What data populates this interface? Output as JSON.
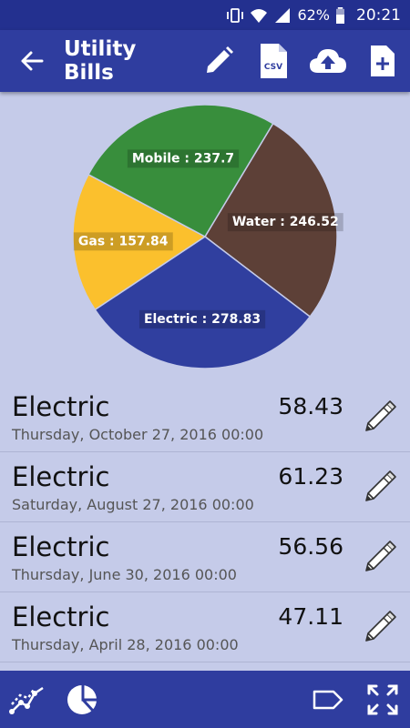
{
  "status_bar": {
    "battery": "62%",
    "time": "20:21",
    "icons": [
      "vibrate-icon",
      "wifi-icon",
      "signal-icon",
      "battery-icon"
    ]
  },
  "app_bar": {
    "title": "Utility Bills",
    "actions": [
      "edit-icon",
      "csv-export-icon",
      "cloud-upload-icon",
      "add-file-icon"
    ]
  },
  "chart_data": {
    "type": "pie",
    "slices": [
      {
        "label": "Water : 246.52",
        "name": "Water",
        "value": 246.52,
        "color": "#5d4037"
      },
      {
        "label": "Electric : 278.83",
        "name": "Electric",
        "value": 278.83,
        "color": "#303f9f"
      },
      {
        "label": "Gas : 157.84",
        "name": "Gas",
        "value": 157.84,
        "color": "#fbc02d"
      },
      {
        "label": "Mobile : 237.7",
        "name": "Mobile",
        "value": 237.7,
        "color": "#388e3c"
      }
    ]
  },
  "bills": [
    {
      "name": "Electric",
      "date": "Thursday, October 27, 2016 00:00",
      "amount": "58.43"
    },
    {
      "name": "Electric",
      "date": "Saturday, August 27, 2016 00:00",
      "amount": "61.23"
    },
    {
      "name": "Electric",
      "date": "Thursday, June 30, 2016 00:00",
      "amount": "56.56"
    },
    {
      "name": "Electric",
      "date": "Thursday, April 28, 2016 00:00",
      "amount": "47.11"
    }
  ],
  "bottom_bar": {
    "icons": [
      "line-chart-icon",
      "pie-chart-icon",
      "tag-icon",
      "fullscreen-icon"
    ]
  },
  "colors": {
    "primary": "#2f3d9f",
    "background": "#c5cbe9"
  }
}
